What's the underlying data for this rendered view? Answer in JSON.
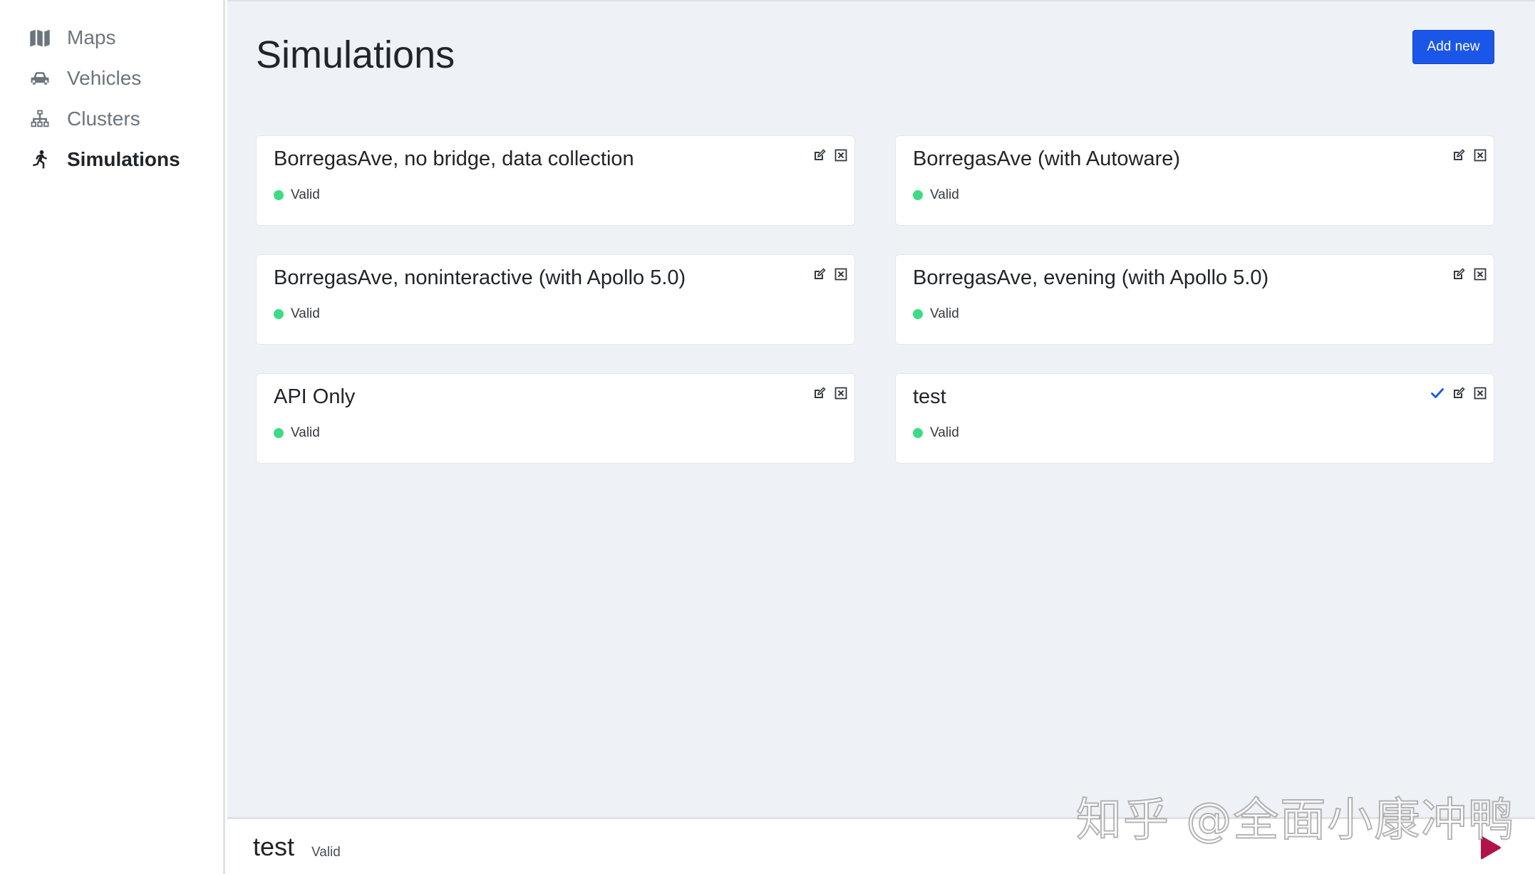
{
  "sidebar": {
    "items": [
      {
        "label": "Maps",
        "icon": "map-icon",
        "active": false
      },
      {
        "label": "Vehicles",
        "icon": "car-icon",
        "active": false
      },
      {
        "label": "Clusters",
        "icon": "network-icon",
        "active": false
      },
      {
        "label": "Simulations",
        "icon": "running-person-icon",
        "active": true
      }
    ]
  },
  "main": {
    "title": "Simulations",
    "add_button": "Add new",
    "cards": [
      {
        "title": "BorregasAve, no bridge, data collection",
        "status": "Valid",
        "selected": false
      },
      {
        "title": "BorregasAve (with Autoware)",
        "status": "Valid",
        "selected": false
      },
      {
        "title": "BorregasAve, noninteractive (with Apollo 5.0)",
        "status": "Valid",
        "selected": false
      },
      {
        "title": "BorregasAve, evening (with Apollo 5.0)",
        "status": "Valid",
        "selected": false
      },
      {
        "title": "API Only",
        "status": "Valid",
        "selected": false
      },
      {
        "title": "test",
        "status": "Valid",
        "selected": true
      }
    ]
  },
  "bottom_bar": {
    "title": "test",
    "status": "Valid"
  },
  "watermark": "知乎 @全面小康冲鸭",
  "colors": {
    "accent": "#1a56e8",
    "valid": "#3ddc84",
    "play": "#b0154a",
    "background": "#eef1f5"
  }
}
